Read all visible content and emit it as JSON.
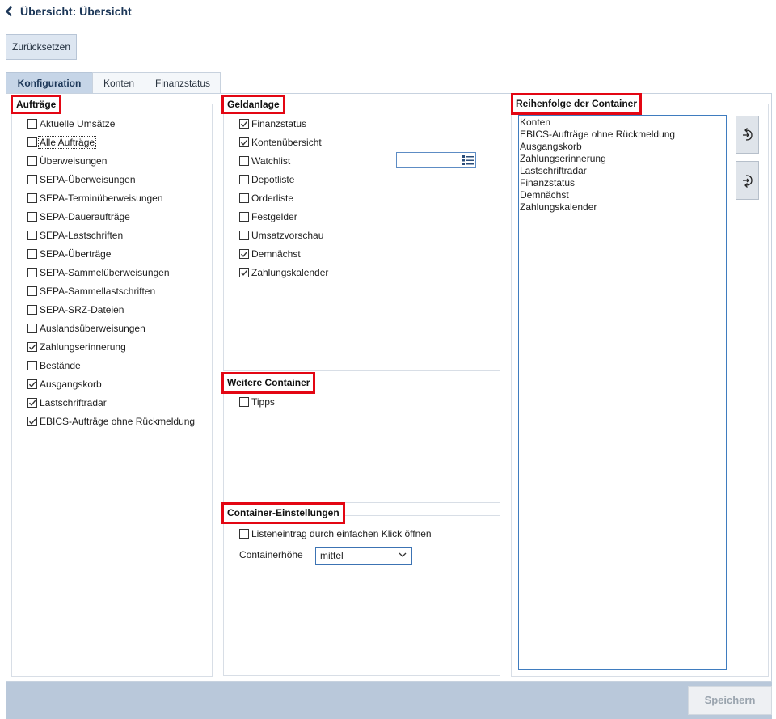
{
  "header": {
    "back_icon": "chevron-left-icon",
    "title": "Übersicht: Übersicht"
  },
  "toolbar": {
    "reset_label": "Zurücksetzen"
  },
  "tabs": [
    {
      "label": "Konfiguration",
      "active": true
    },
    {
      "label": "Konten",
      "active": false
    },
    {
      "label": "Finanzstatus",
      "active": false
    }
  ],
  "groups": {
    "auftraege": {
      "title": "Aufträge",
      "items": [
        {
          "label": "Aktuelle Umsätze",
          "checked": false
        },
        {
          "label": "Alle Aufträge",
          "checked": false,
          "focused": true
        },
        {
          "label": "Überweisungen",
          "checked": false
        },
        {
          "label": "SEPA-Überweisungen",
          "checked": false
        },
        {
          "label": "SEPA-Terminüberweisungen",
          "checked": false
        },
        {
          "label": "SEPA-Daueraufträge",
          "checked": false
        },
        {
          "label": "SEPA-Lastschriften",
          "checked": false
        },
        {
          "label": "SEPA-Überträge",
          "checked": false
        },
        {
          "label": "SEPA-Sammelüberweisungen",
          "checked": false
        },
        {
          "label": "SEPA-Sammellastschriften",
          "checked": false
        },
        {
          "label": "SEPA-SRZ-Dateien",
          "checked": false
        },
        {
          "label": "Auslandsüberweisungen",
          "checked": false
        },
        {
          "label": "Zahlungserinnerung",
          "checked": true
        },
        {
          "label": "Bestände",
          "checked": false
        },
        {
          "label": "Ausgangskorb",
          "checked": true
        },
        {
          "label": "Lastschriftradar",
          "checked": true
        },
        {
          "label": "EBICS-Aufträge ohne Rückmeldung",
          "checked": true
        }
      ]
    },
    "geldanlage": {
      "title": "Geldanlage",
      "items": [
        {
          "label": "Finanzstatus",
          "checked": true
        },
        {
          "label": "Kontenübersicht",
          "checked": true
        },
        {
          "label": "Watchlist",
          "checked": false
        },
        {
          "label": "Depotliste",
          "checked": false
        },
        {
          "label": "Orderliste",
          "checked": false
        },
        {
          "label": "Festgelder",
          "checked": false
        },
        {
          "label": "Umsatzvorschau",
          "checked": false
        },
        {
          "label": "Demnächst",
          "checked": true
        },
        {
          "label": "Zahlungskalender",
          "checked": true
        }
      ],
      "watchlist_select_icon": "list-icon"
    },
    "weitere": {
      "title": "Weitere Container",
      "items": [
        {
          "label": "Tipps",
          "checked": false
        }
      ]
    },
    "einstellungen": {
      "title": "Container-Einstellungen",
      "items": [
        {
          "label": "Listeneintrag durch einfachen Klick öffnen",
          "checked": false
        }
      ],
      "height_label": "Containerhöhe",
      "height_value": "mittel"
    },
    "reihenfolge": {
      "title": "Reihenfolge der Container",
      "items": [
        "Konten",
        "EBICS-Aufträge ohne Rückmeldung",
        "Ausgangskorb",
        "Zahlungserinnerung",
        "Lastschriftradar",
        "Finanzstatus",
        "Demnächst",
        "Zahlungskalender"
      ],
      "move_up_icon": "move-up-icon",
      "move_down_icon": "move-down-icon"
    }
  },
  "footer": {
    "save_label": "Speichern",
    "save_enabled": false
  },
  "colors": {
    "highlight": "#e30613",
    "title_text": "#1b3657",
    "tab_active_bg": "#c6d5e7",
    "footer_bg": "#b9c8da",
    "listbox_border": "#3f7cbf"
  }
}
